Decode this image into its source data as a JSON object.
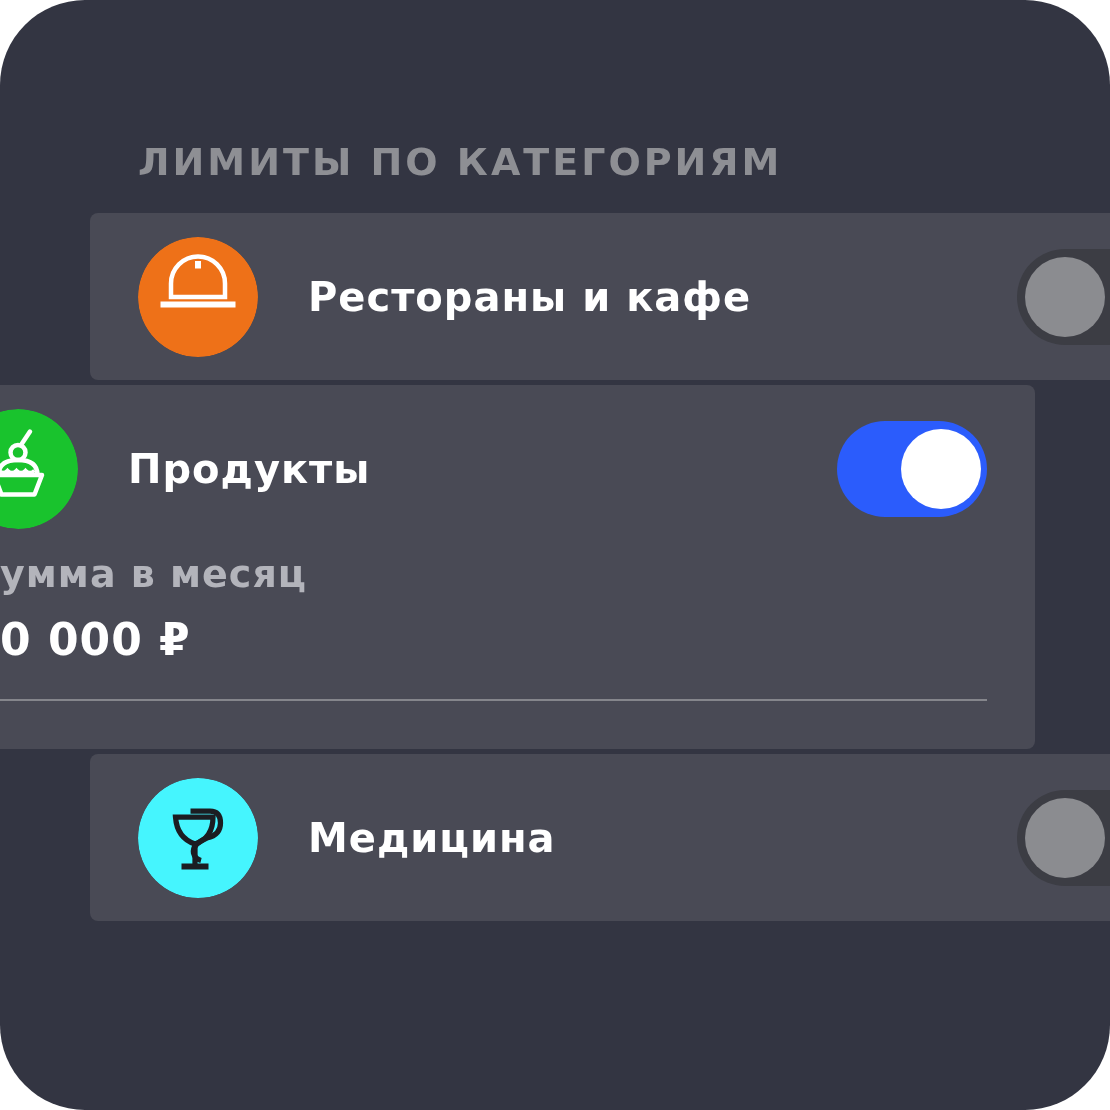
{
  "header": "ЛИМИТЫ ПО КАТЕГОРИЯМ",
  "categories": [
    {
      "name": "Рестораны и кафе",
      "kind": "cloche",
      "color": "#ee7118",
      "on": false
    },
    {
      "name": "Продукты",
      "kind": "cupcake",
      "color": "#19c32d",
      "on": true,
      "limit": {
        "label": "умма в месяц",
        "value": "0 000 ₽"
      }
    },
    {
      "name": "Медицина",
      "kind": "bowl",
      "color": "#45f5fe",
      "on": false
    }
  ]
}
